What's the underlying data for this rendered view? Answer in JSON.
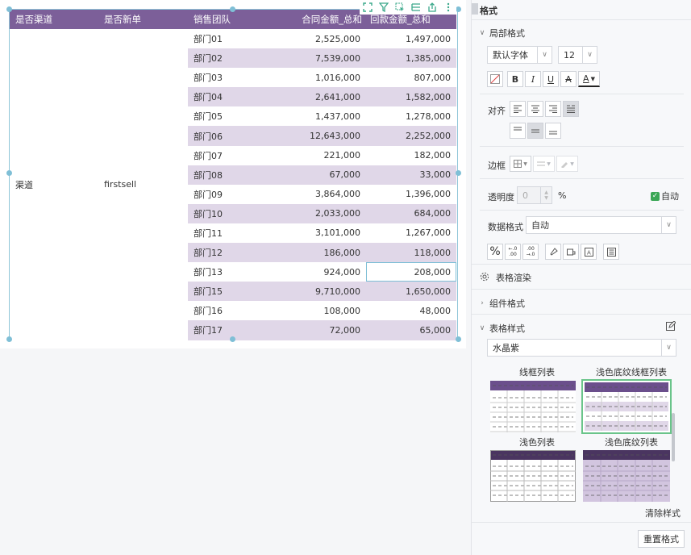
{
  "table": {
    "headers": [
      "是否渠道",
      "是否新单",
      "销售团队",
      "合同金额_总和",
      "回款金额_总和"
    ],
    "merged_channel": "渠道",
    "merged_new": "firstsell",
    "rows": [
      {
        "dept": "部门01",
        "contract": "2,525,000",
        "payment": "1,497,000"
      },
      {
        "dept": "部门02",
        "contract": "7,539,000",
        "payment": "1,385,000"
      },
      {
        "dept": "部门03",
        "contract": "1,016,000",
        "payment": "807,000"
      },
      {
        "dept": "部门04",
        "contract": "2,641,000",
        "payment": "1,582,000"
      },
      {
        "dept": "部门05",
        "contract": "1,437,000",
        "payment": "1,278,000"
      },
      {
        "dept": "部门06",
        "contract": "12,643,000",
        "payment": "2,252,000"
      },
      {
        "dept": "部门07",
        "contract": "221,000",
        "payment": "182,000"
      },
      {
        "dept": "部门08",
        "contract": "67,000",
        "payment": "33,000"
      },
      {
        "dept": "部门09",
        "contract": "3,864,000",
        "payment": "1,396,000"
      },
      {
        "dept": "部门10",
        "contract": "2,033,000",
        "payment": "684,000"
      },
      {
        "dept": "部门11",
        "contract": "3,101,000",
        "payment": "1,267,000"
      },
      {
        "dept": "部门12",
        "contract": "186,000",
        "payment": "118,000"
      },
      {
        "dept": "部门13",
        "contract": "924,000",
        "payment": "208,000"
      },
      {
        "dept": "部门15",
        "contract": "9,710,000",
        "payment": "1,650,000"
      },
      {
        "dept": "部门16",
        "contract": "108,000",
        "payment": "48,000"
      },
      {
        "dept": "部门17",
        "contract": "72,000",
        "payment": "65,000"
      }
    ],
    "selected_row_index": 12
  },
  "toolbar_icons": [
    "expand-icon",
    "filter-icon",
    "select-icon",
    "list-icon",
    "export-icon",
    "more-icon"
  ],
  "panel": {
    "title": "格式",
    "local_format": {
      "section_title": "局部格式",
      "font_family": "默认字体",
      "font_size": "12",
      "style_buttons": [
        "B",
        "I",
        "U",
        "A",
        "A"
      ],
      "align_label": "对齐",
      "border_label": "边框",
      "opacity_label": "透明度",
      "opacity_value": "0",
      "opacity_unit": "%",
      "auto_label": "自动",
      "data_format_label": "数据格式",
      "data_format_value": "自动",
      "number_buttons": [
        "%",
        ".0",
        ".00"
      ]
    },
    "table_render": "表格渲染",
    "component_format": "组件格式",
    "table_style": {
      "section_title": "表格样式",
      "theme_value": "水晶紫",
      "styles": [
        "线框列表",
        "浅色底纹线框列表",
        "浅色列表",
        "浅色底纹列表"
      ],
      "selected_index": 1,
      "clear_label": "清除样式"
    },
    "reset_label": "重置格式"
  },
  "colors": {
    "header": "#7c5f99",
    "stripe": "#e0d7e8",
    "selection": "#7fbfd6",
    "check": "#3aa655"
  }
}
